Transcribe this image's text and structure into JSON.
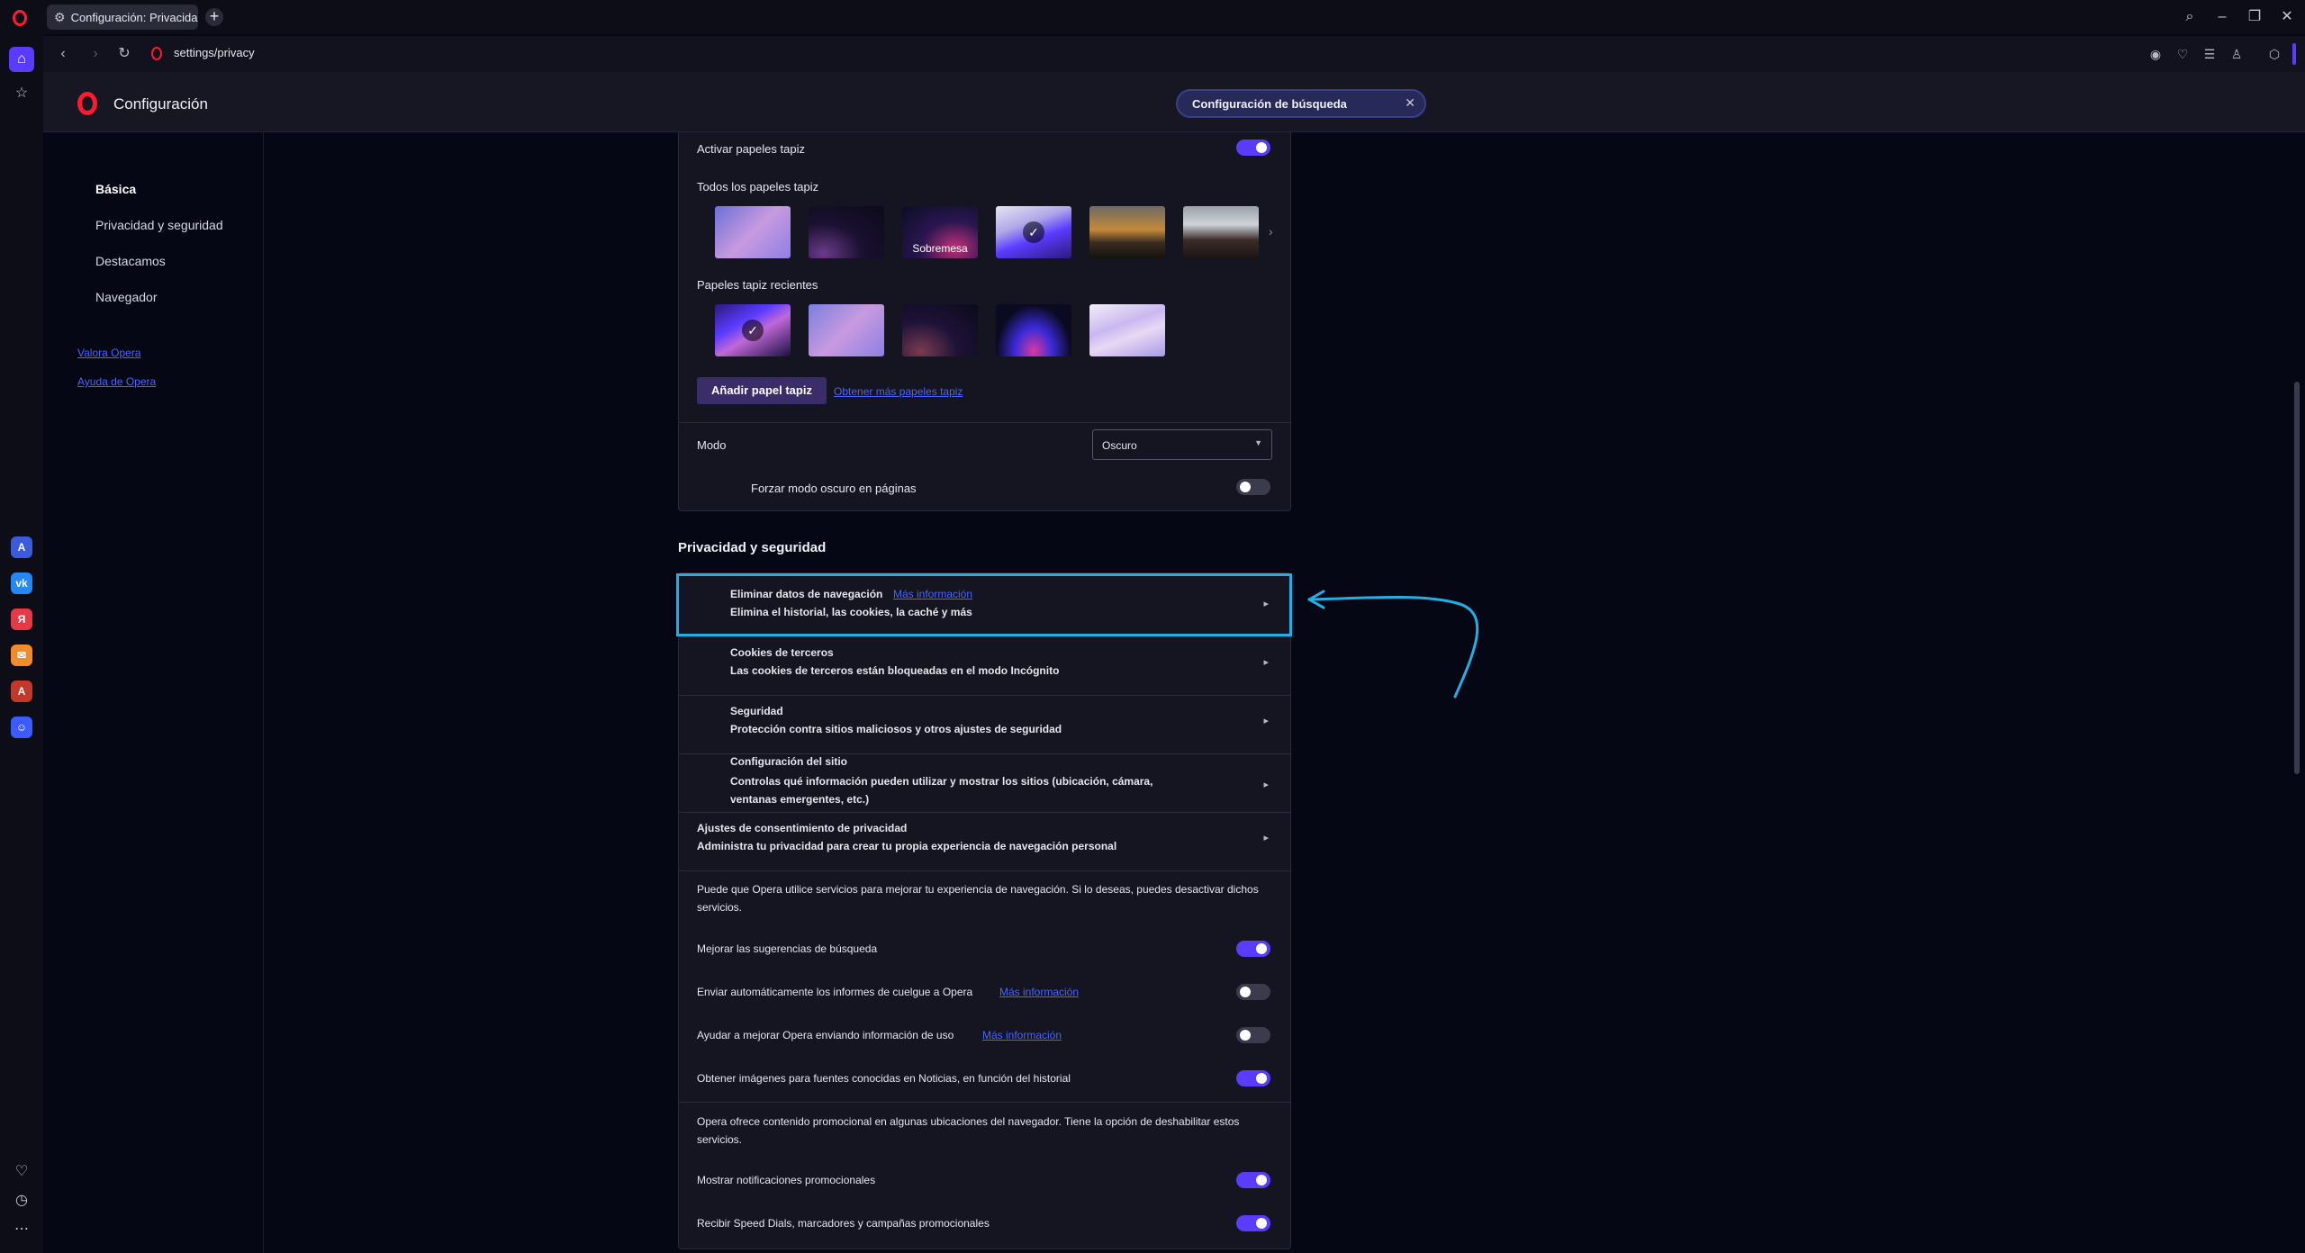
{
  "browser": {
    "tab_title": "Configuración: Privacidad",
    "url": "settings/privacy",
    "new_tab_symbol": "+"
  },
  "header": {
    "title": "Configuración",
    "search_chip": "Configuración de búsqueda"
  },
  "nav": {
    "items": [
      "Básica",
      "Privacidad y seguridad",
      "Destacamos",
      "Navegador"
    ],
    "links": [
      "Valora Opera",
      "Ayuda de Opera"
    ]
  },
  "wallpapers": {
    "enable_label": "Activar papeles tapiz",
    "enable_on": true,
    "all_label": "Todos los papeles tapiz",
    "desktop_caption": "Sobremesa",
    "recent_label": "Papeles tapiz recientes",
    "add_button": "Añadir papel tapiz",
    "more_link": "Obtener más papeles tapiz"
  },
  "mode": {
    "label": "Modo",
    "value": "Oscuro",
    "force_dark_label": "Forzar modo oscuro en páginas",
    "force_dark_on": false
  },
  "privacy": {
    "section_title": "Privacidad y seguridad",
    "items": [
      {
        "title": "Eliminar datos de navegación",
        "link": "Más información",
        "subtitle": "Elimina el historial, las cookies, la caché y más"
      },
      {
        "title": "Cookies de terceros",
        "subtitle": "Las cookies de terceros están bloqueadas en el modo Incógnito"
      },
      {
        "title": "Seguridad",
        "subtitle": "Protección contra sitios maliciosos y otros ajustes de seguridad"
      },
      {
        "title": "Configuración del sitio",
        "subtitle": "Controlas qué información pueden utilizar y mostrar los sitios (ubicación, cámara, ventanas emergentes, etc.)"
      },
      {
        "title": "Ajustes de consentimiento de privacidad",
        "subtitle": "Administra tu privacidad para crear tu propia experiencia de navegación personal"
      }
    ],
    "services_intro": "Puede que Opera utilice servicios para mejorar tu experiencia de navegación. Si lo deseas, puedes desactivar dichos servicios.",
    "toggles": [
      {
        "label": "Mejorar las sugerencias de búsqueda",
        "on": true
      },
      {
        "label": "Enviar automáticamente los informes de cuelgue a Opera",
        "link": "Más información",
        "on": false
      },
      {
        "label": "Ayudar a mejorar Opera enviando información de uso",
        "link": "Más información",
        "on": false
      },
      {
        "label": "Obtener imágenes para fuentes conocidas en Noticias, en función del historial",
        "on": true
      }
    ],
    "promo_intro": "Opera ofrece contenido promocional en algunas ubicaciones del navegador. Tiene la opción de deshabilitar estos servicios.",
    "promo_toggles": [
      {
        "label": "Mostrar notificaciones promocionales",
        "on": true
      },
      {
        "label": "Recibir Speed Dials, marcadores y campañas promocionales",
        "on": true
      }
    ]
  },
  "colors": {
    "accent": "#5b3bff",
    "link": "#4a64ff",
    "highlight": "#21b0e6"
  }
}
